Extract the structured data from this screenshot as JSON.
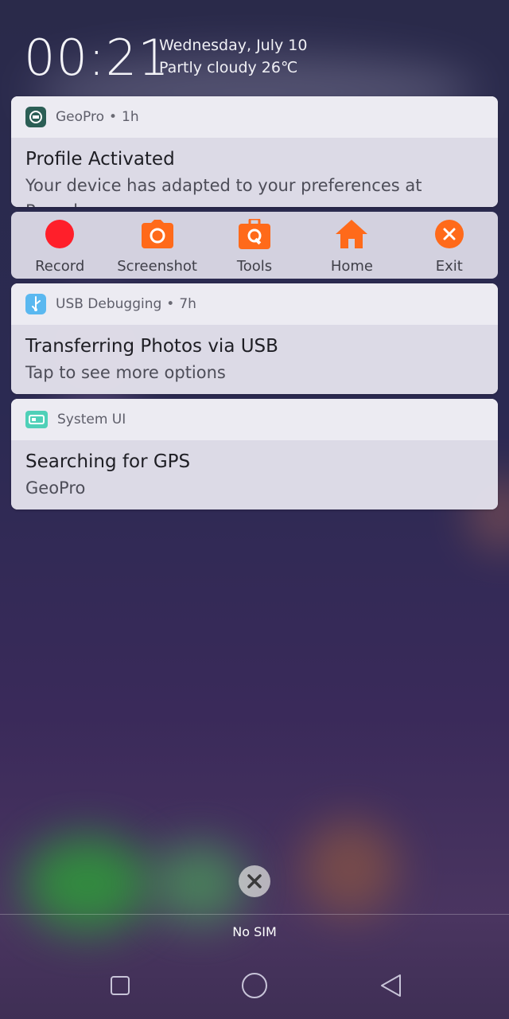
{
  "lockscreen": {
    "time": "00:21",
    "date": "Wednesday, July 10",
    "weather": "Partly cloudy 26℃"
  },
  "notifications": [
    {
      "app": "GeoPro",
      "age": "1h",
      "title": "Profile Activated",
      "text": "Your device has adapted to your preferences at Rumah",
      "icon": "geopro-icon",
      "icon_color": "#2b5e55"
    },
    {
      "app": "USB Debugging",
      "age": "7h",
      "title": "Transferring Photos via USB",
      "text": "Tap to see more options",
      "icon": "usb-icon",
      "icon_color": "#5ab8f0"
    },
    {
      "app": "System UI",
      "title": "Searching for GPS",
      "text": "GeoPro",
      "icon": "system-ui-icon",
      "icon_color": "#4fd0b8"
    }
  ],
  "toolbar": {
    "record_label": "Record",
    "screenshot_label": "Screenshot",
    "tools_label": "Tools",
    "home_label": "Home",
    "exit_label": "Exit",
    "accent_color": "#ff6a1a",
    "record_color": "#ff1f2a"
  },
  "status": {
    "sim": "No SIM"
  },
  "navbar": {
    "buttons": [
      "recent-apps",
      "home",
      "back"
    ]
  }
}
